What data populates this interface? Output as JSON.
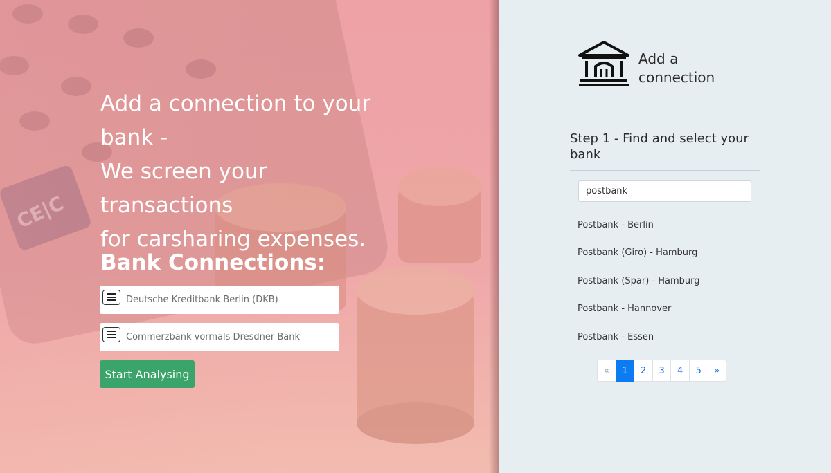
{
  "hero": {
    "headline_lines": [
      "Add a connection to your",
      "bank -",
      "We screen your transactions",
      "for carsharing expenses."
    ],
    "connections_title": "Bank Connections:",
    "connections": [
      {
        "label": "Deutsche Kreditbank Berlin (DKB)",
        "icon": "menu-icon"
      },
      {
        "label": "Commerzbank vormals Dresdner Bank",
        "icon": "menu-icon"
      }
    ],
    "start_button": "Start Analysing"
  },
  "panel": {
    "icon": "bank-building-icon",
    "title_lines": [
      "Add a",
      "connection"
    ],
    "step_title": "Step 1 - Find and select your bank",
    "search_value": "postbank",
    "results": [
      "Postbank - Berlin",
      "Postbank (Giro) - Hamburg",
      "Postbank (Spar) - Hamburg",
      "Postbank - Hannover",
      "Postbank - Essen"
    ],
    "pagination": {
      "prev": "«",
      "pages": [
        "1",
        "2",
        "3",
        "4",
        "5"
      ],
      "next": "»",
      "active_page": "1"
    }
  },
  "colors": {
    "hero_bg": "#eea2a5",
    "start_button": "#3aa46a",
    "panel_bg": "#e6eef1",
    "active_page": "#0d7cf2"
  }
}
